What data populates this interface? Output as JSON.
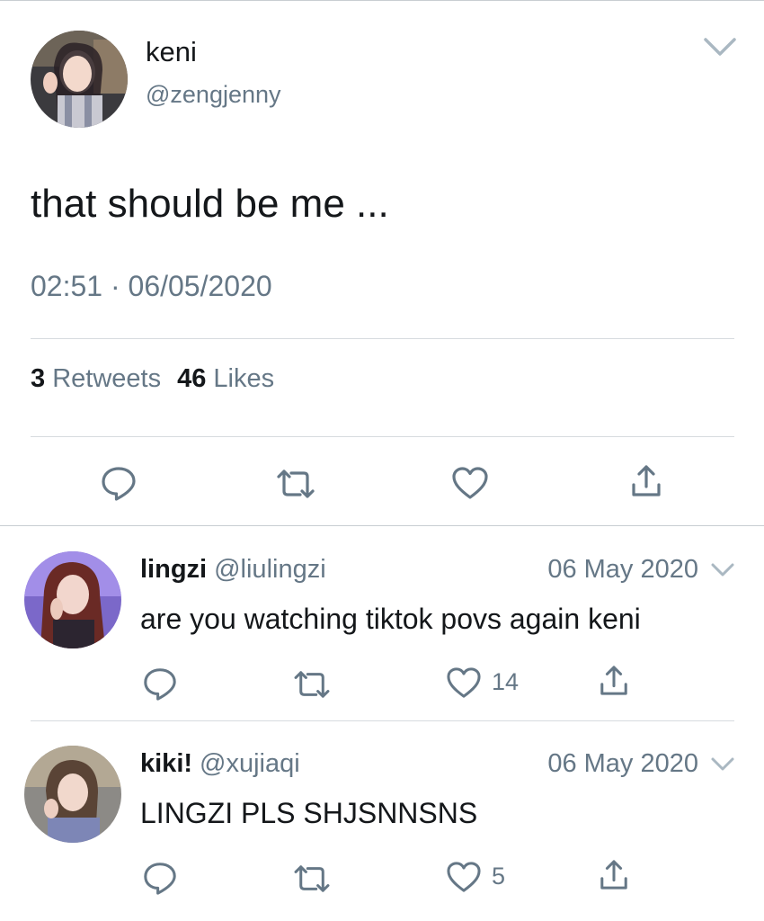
{
  "main_tweet": {
    "author_name": "keni",
    "author_handle": "@zengjenny",
    "text": "that should be me ...",
    "time": "02:51",
    "separator": "·",
    "date": "06/05/2020",
    "retweets_count": "3",
    "retweets_label": "Retweets",
    "likes_count": "46",
    "likes_label": "Likes"
  },
  "replies": [
    {
      "name": "lingzi",
      "handle": "@liulingzi",
      "date": "06 May 2020",
      "text": "are you watching tiktok povs again keni",
      "likes": "14"
    },
    {
      "name": "kiki!",
      "handle": "@xujiaqi",
      "date": "06 May 2020",
      "text": "LINGZI PLS SHJSNNSNS",
      "likes": "5"
    }
  ],
  "colors": {
    "text_primary": "#14171a",
    "text_secondary": "#657786",
    "icon": "#657786",
    "divider": "#d7dbdf"
  },
  "icons": [
    "chevron-down-icon",
    "reply-icon",
    "retweet-icon",
    "like-icon",
    "share-icon"
  ]
}
